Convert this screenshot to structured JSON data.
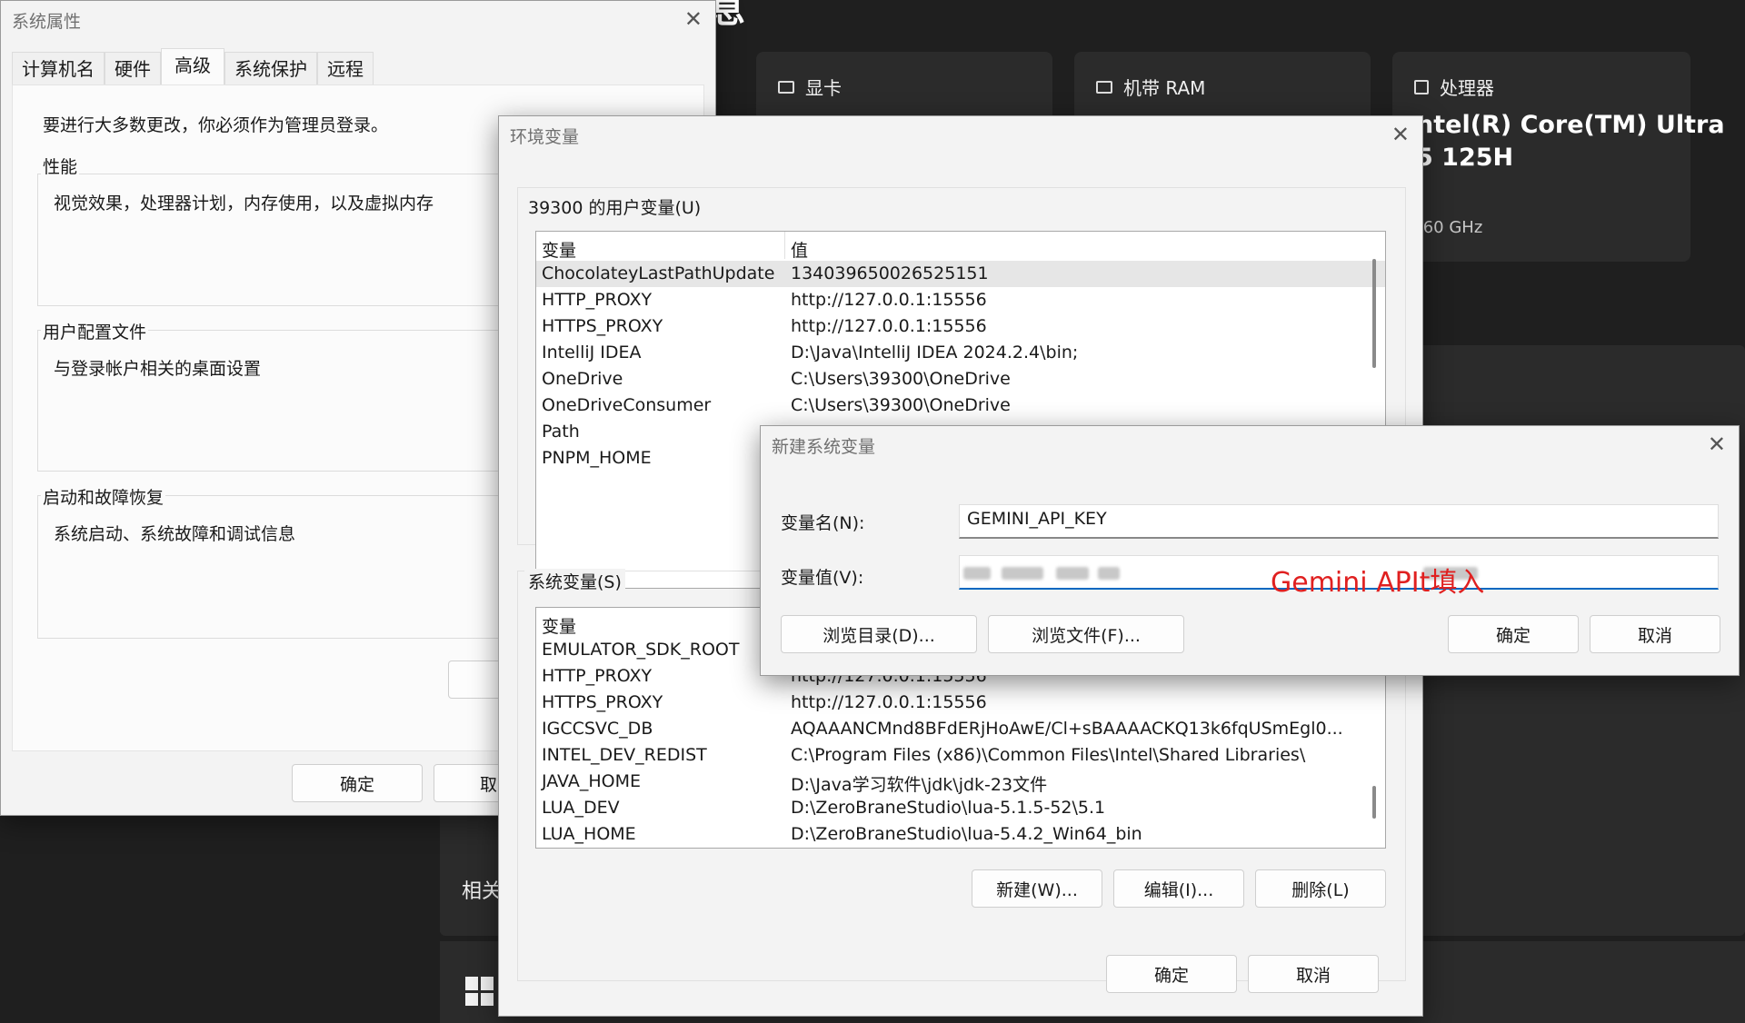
{
  "background": {
    "title": "息",
    "cards": [
      {
        "label": "显卡"
      },
      {
        "label": "机带 RAM"
      },
      {
        "label": "处理器"
      }
    ],
    "processor_value_line1": "ntel(R) Core(TM) Ultra",
    "processor_value_line2": "5 125H",
    "processor_freq": ".60 GHz",
    "related_label": "相关"
  },
  "system_properties": {
    "title": "系统属性",
    "tabs": [
      "计算机名",
      "硬件",
      "高级",
      "系统保护",
      "远程"
    ],
    "active_tab": "高级",
    "admin_notice": "要进行大多数更改，你必须作为管理员登录。",
    "performance": {
      "label": "性能",
      "desc": "视觉效果，处理器计划，内存使用，以及虚拟内存"
    },
    "user_profile": {
      "label": "用户配置文件",
      "desc": "与登录帐户相关的桌面设置"
    },
    "startup_recovery": {
      "label": "启动和故障恢复",
      "desc": "系统启动、系统故障和调试信息"
    },
    "ok_label": "确定",
    "cancel_label": "取"
  },
  "environment_variables": {
    "title": "环境变量",
    "user_section_label": "39300 的用户变量(U)",
    "system_section_label": "系统变量(S)",
    "col_variable": "变量",
    "col_value": "值",
    "user_vars": [
      {
        "name": "ChocolateyLastPathUpdate",
        "value": "134039650026525151"
      },
      {
        "name": "HTTP_PROXY",
        "value": "http://127.0.0.1:15556"
      },
      {
        "name": "HTTPS_PROXY",
        "value": "http://127.0.0.1:15556"
      },
      {
        "name": "IntelliJ IDEA",
        "value": "D:\\Java\\IntelliJ IDEA 2024.2.4\\bin;"
      },
      {
        "name": "OneDrive",
        "value": "C:\\Users\\39300\\OneDrive"
      },
      {
        "name": "OneDriveConsumer",
        "value": "C:\\Users\\39300\\OneDrive"
      },
      {
        "name": "Path",
        "value": ""
      },
      {
        "name": "PNPM_HOME",
        "value": ""
      }
    ],
    "system_vars": [
      {
        "name": "EMULATOR_SDK_ROOT",
        "value": ""
      },
      {
        "name": "HTTP_PROXY",
        "value": "http://127.0.0.1:15556"
      },
      {
        "name": "HTTPS_PROXY",
        "value": "http://127.0.0.1:15556"
      },
      {
        "name": "IGCCSVC_DB",
        "value": "AQAAANCMnd8BFdERjHoAwE/Cl+sBAAAACKQ13k6fqUSmEgl0..."
      },
      {
        "name": "INTEL_DEV_REDIST",
        "value": "C:\\Program Files (x86)\\Common Files\\Intel\\Shared Libraries\\"
      },
      {
        "name": "JAVA_HOME",
        "value": "D:\\Java学习软件\\jdk\\jdk-23文件"
      },
      {
        "name": "LUA_DEV",
        "value": "D:\\ZeroBraneStudio\\lua-5.1.5-52\\5.1"
      },
      {
        "name": "LUA_HOME",
        "value": "D:\\ZeroBraneStudio\\lua-5.4.2_Win64_bin"
      }
    ],
    "new_label": "新建(W)...",
    "edit_label": "编辑(I)...",
    "delete_label": "删除(L)",
    "ok_label": "确定",
    "cancel_label": "取消"
  },
  "new_system_variable": {
    "title": "新建系统变量",
    "name_label": "变量名(N):",
    "name_value": "GEMINI_API_KEY",
    "value_label": "变量值(V):",
    "value_overlay_note": "Gemini APIt填入",
    "browse_dir_label": "浏览目录(D)...",
    "browse_file_label": "浏览文件(F)...",
    "ok_label": "确定",
    "cancel_label": "取消"
  }
}
